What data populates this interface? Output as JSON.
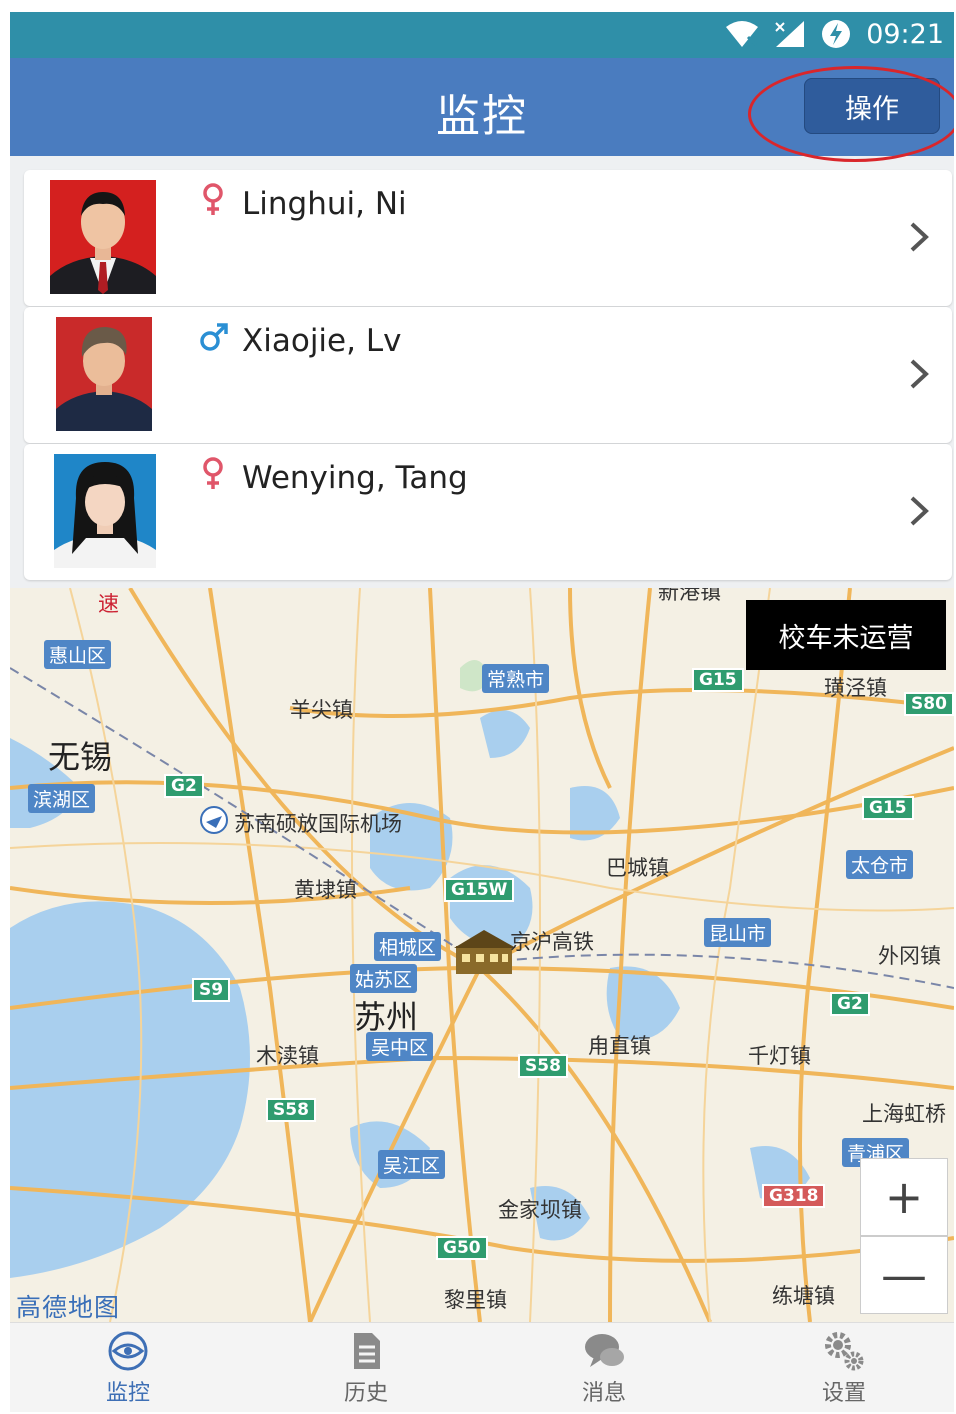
{
  "status_bar": {
    "time": "09:21"
  },
  "header": {
    "title": "监控",
    "action_label": "操作"
  },
  "students": [
    {
      "name": "Linghui, Ni",
      "gender": "female"
    },
    {
      "name": "Xiaojie, Lv",
      "gender": "male"
    },
    {
      "name": "Wenying, Tang",
      "gender": "female"
    }
  ],
  "map": {
    "notice": "校车未运营",
    "brand": "高德地图",
    "zoom_in": "+",
    "zoom_out": "—",
    "labels": {
      "wuxi": "无锡",
      "suzhou": "苏州",
      "yangjian": "羊尖镇",
      "huangdai": "黄埭镇",
      "bacheng": "巴城镇",
      "huangjing": "璜泾镇",
      "waigang": "外冈镇",
      "mudu": "木渎镇",
      "yongzhi": "甪直镇",
      "qiandeng": "千灯镇",
      "jinjiaba": "金家坝镇",
      "lili": "黎里镇",
      "liantang": "练塘镇",
      "shanghai_hong": "上海虹桥",
      "airport": "苏南硕放国际机场",
      "railway": "京沪高铁",
      "top_cut": "新港镇",
      "fast": "速"
    },
    "districts": {
      "huishan": "惠山区",
      "binhu": "滨湖区",
      "changshu": "常熟市",
      "xiangcheng": "相城区",
      "gusu": "姑苏区",
      "wuzhong": "吴中区",
      "kunshan": "昆山市",
      "taicang": "太仓市",
      "wujiang": "吴江区",
      "qingpu": "青浦区"
    },
    "highways": {
      "g15a": "G15",
      "s80": "S80",
      "g2a": "G2",
      "g15b": "G15",
      "g15w": "G15W",
      "s9": "S9",
      "g2b": "G2",
      "s58a": "S58",
      "s58b": "S58",
      "g318": "G318",
      "g50": "G50"
    }
  },
  "tabs": [
    {
      "label": "监控",
      "icon": "eye-icon",
      "active": true
    },
    {
      "label": "历史",
      "icon": "document-icon",
      "active": false
    },
    {
      "label": "消息",
      "icon": "chat-icon",
      "active": false
    },
    {
      "label": "设置",
      "icon": "gear-icon",
      "active": false
    }
  ]
}
